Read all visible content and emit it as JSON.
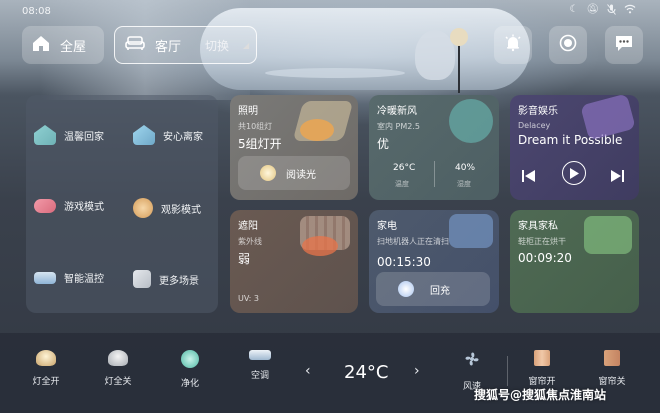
{
  "status_bar": {
    "time": "08:08"
  },
  "top_bar": {
    "home_label": "全屋",
    "room_label": "客厅",
    "switch_label": "切换"
  },
  "scenes": [
    {
      "label": "温馨回家",
      "icon": "house-icon"
    },
    {
      "label": "安心离家",
      "icon": "house-leave-icon"
    },
    {
      "label": "游戏模式",
      "icon": "gamepad-icon"
    },
    {
      "label": "观影模式",
      "icon": "film-icon"
    },
    {
      "label": "智能温控",
      "icon": "ac-icon"
    },
    {
      "label": "更多场景",
      "icon": "more-scenes-icon"
    }
  ],
  "cards": {
    "lighting": {
      "title": "照明",
      "sub": "共10组灯",
      "value": "5组灯开",
      "action": "阅读光",
      "accent": "#b89a6a"
    },
    "fresh_air": {
      "title": "冷暖新风",
      "sub": "室内 PM2.5",
      "value": "优",
      "temp": "26°C",
      "temp_label": "温度",
      "humidity": "40%",
      "humidity_label": "湿度",
      "accent": "#3f8a86"
    },
    "media": {
      "title": "影音娱乐",
      "sub": "Delacey",
      "value": "Dream it Possible",
      "accent": "#6c5aa0"
    },
    "shade": {
      "title": "遮阳",
      "sub": "紫外线",
      "value": "弱",
      "uv": "UV: 3",
      "accent": "#a9583c"
    },
    "appliance": {
      "title": "家电",
      "sub": "扫地机器人正在清扫",
      "value": "00:15:30",
      "action": "回充",
      "accent": "#3e5f8c"
    },
    "furniture": {
      "title": "家具家私",
      "sub": "鞋柜正在烘干",
      "value": "00:09:20",
      "accent": "#4f8a52"
    }
  },
  "dock": {
    "items": [
      {
        "label": "灯全开",
        "icon": "light-on-icon"
      },
      {
        "label": "灯全关",
        "icon": "light-off-icon"
      },
      {
        "label": "净化",
        "icon": "purifier-icon"
      },
      {
        "label": "空调",
        "icon": "ac-unit-icon"
      }
    ],
    "temperature": "24°C",
    "right_items": [
      {
        "label": "风速",
        "icon": "fan-icon"
      },
      {
        "label": "窗帘开",
        "icon": "curtain-open-icon"
      },
      {
        "label": "窗帘关",
        "icon": "curtain-close-icon"
      }
    ],
    "watermark": "搜狐号@搜狐焦点淮南站"
  }
}
